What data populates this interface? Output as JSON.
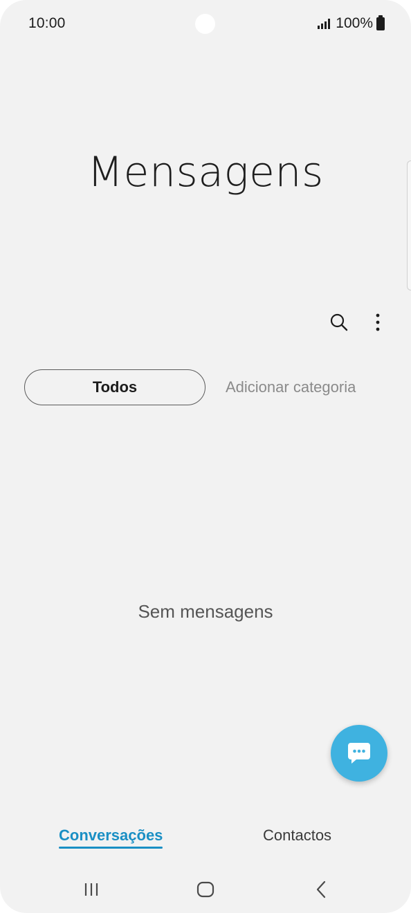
{
  "status_bar": {
    "time": "10:00",
    "battery_text": "100%"
  },
  "header": {
    "title": "Mensagens"
  },
  "toolbar": {
    "search_icon": "search-icon",
    "more_icon": "more-vertical-icon"
  },
  "categories": {
    "active": "Todos",
    "add": "Adicionar categoria"
  },
  "empty_state": {
    "text": "Sem mensagens"
  },
  "fab": {
    "icon": "chat-bubble-icon",
    "color": "#3fb2e0"
  },
  "bottom_tabs": {
    "conversations": "Conversações",
    "contacts": "Contactos",
    "active_color": "#1a8fc4"
  },
  "nav_bar": {
    "recents_icon": "recents-icon",
    "home_icon": "home-icon",
    "back_icon": "back-icon"
  }
}
